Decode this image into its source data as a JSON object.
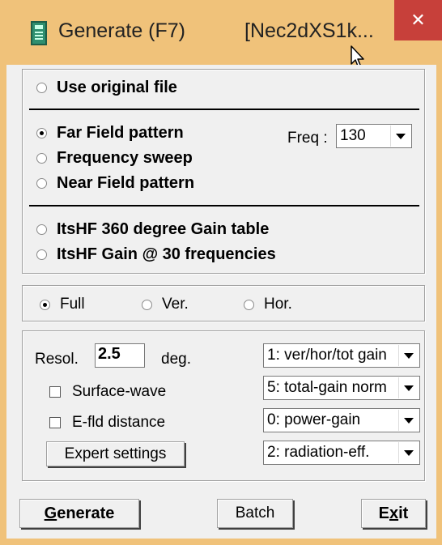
{
  "window": {
    "title": "Generate (F7)",
    "title_file": "[Nec2dXS1k...",
    "close_glyph": "✕",
    "accent_color": "#f0c27a",
    "close_color": "#c7403a"
  },
  "source": {
    "use_original_label": "Use original file"
  },
  "mode": {
    "far_field_label": "Far Field pattern",
    "frequency_sweep_label": "Frequency sweep",
    "near_field_label": "Near Field pattern",
    "freq_label": "Freq :",
    "freq_value": "130",
    "itshf_360_label": "ItsHF 360 degree Gain table",
    "itshf_30_label": "ItsHF Gain @ 30 frequencies",
    "selected": "far_field"
  },
  "pattern": {
    "full_label": "Full",
    "ver_label": "Ver.",
    "hor_label": "Hor.",
    "selected": "full"
  },
  "settings": {
    "resol_label": "Resol.",
    "resol_value": "2.5",
    "deg_label": "deg.",
    "surface_wave_label": "Surface-wave",
    "efld_distance_label": "E-fld distance",
    "expert_settings_label": "Expert settings",
    "combo1": "1: ver/hor/tot gain",
    "combo2": "5: total-gain norm",
    "combo3": "0: power-gain",
    "combo4": "2: radiation-eff."
  },
  "buttons": {
    "generate_prefix": "G",
    "generate_rest": "enerate",
    "batch_label": "Batch",
    "exit_prefix": "E",
    "exit_underline": "x",
    "exit_rest": "it"
  }
}
